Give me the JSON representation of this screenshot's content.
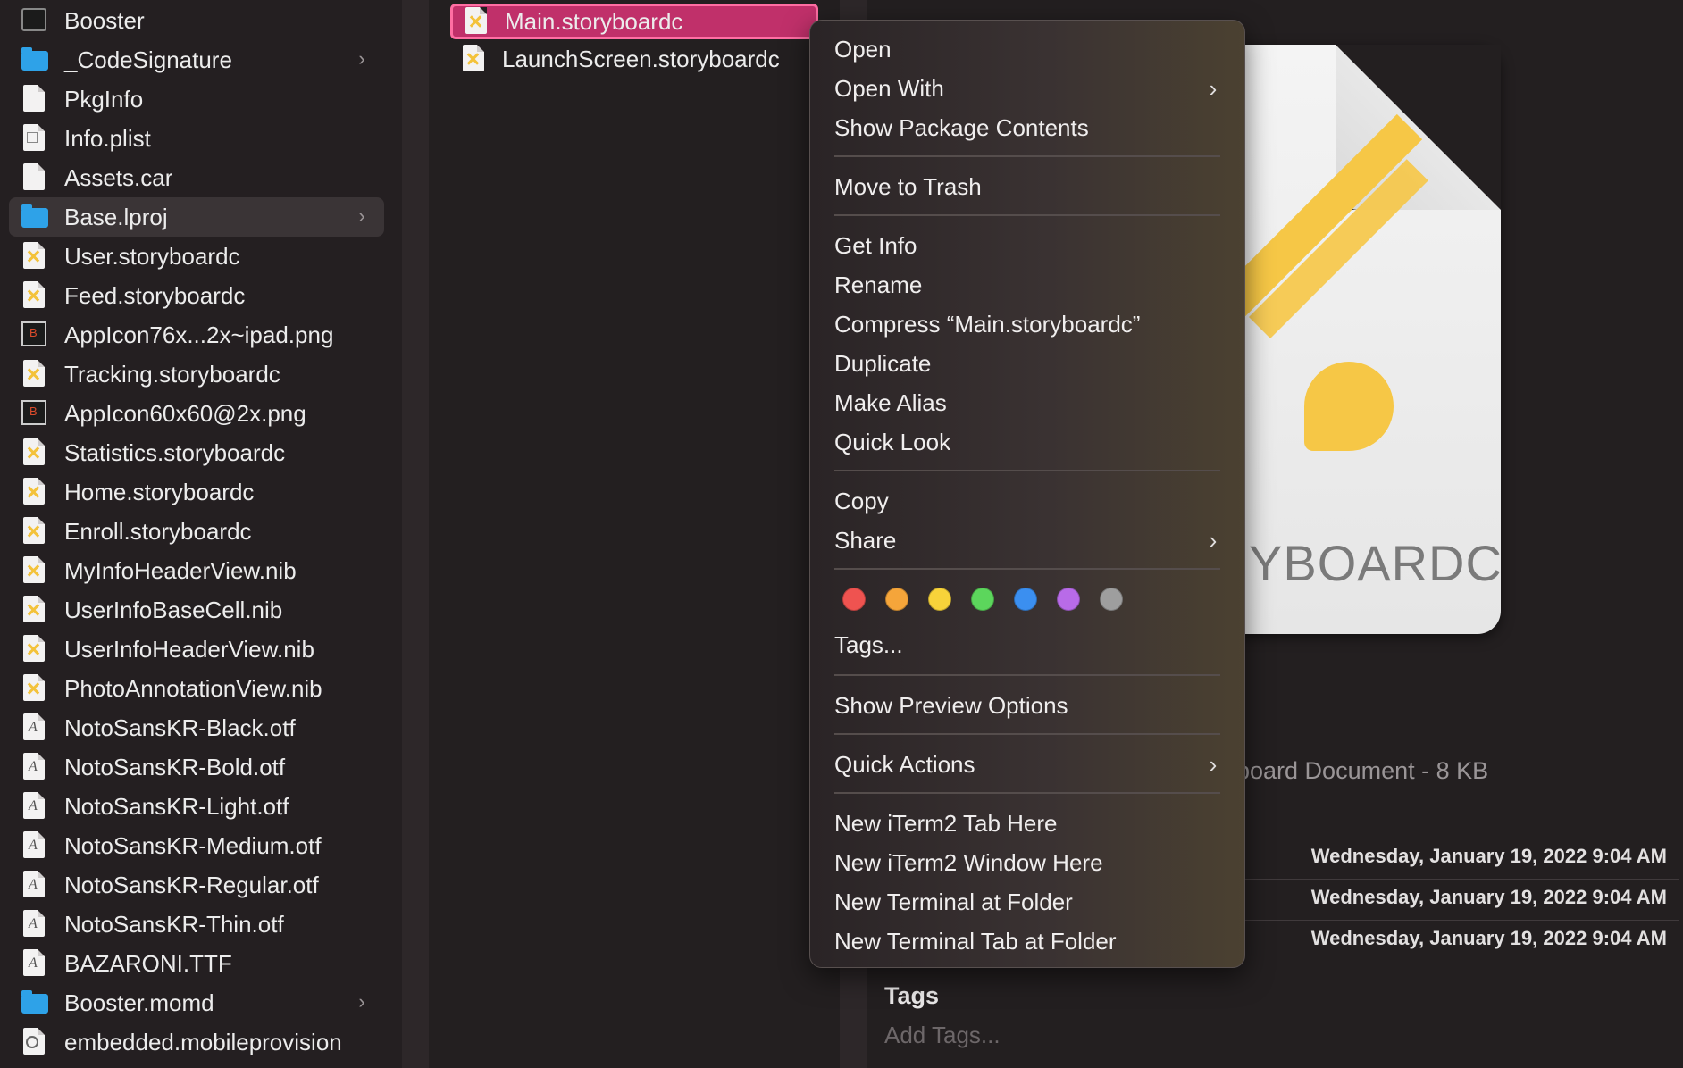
{
  "sidebar": {
    "items": [
      {
        "label": "Booster",
        "icon": "terminal-icon",
        "chevron": false
      },
      {
        "label": "_CodeSignature",
        "icon": "folder-icon",
        "chevron": true
      },
      {
        "label": "PkgInfo",
        "icon": "document-icon",
        "chevron": false
      },
      {
        "label": "Info.plist",
        "icon": "plist-icon",
        "chevron": false
      },
      {
        "label": "Assets.car",
        "icon": "document-icon",
        "chevron": false
      },
      {
        "label": "Base.lproj",
        "icon": "folder-icon",
        "chevron": true,
        "selected": true
      },
      {
        "label": "User.storyboardc",
        "icon": "storyboard-icon",
        "chevron": false
      },
      {
        "label": "Feed.storyboardc",
        "icon": "storyboard-icon",
        "chevron": false
      },
      {
        "label": "AppIcon76x...2x~ipad.png",
        "icon": "image-icon",
        "chevron": false
      },
      {
        "label": "Tracking.storyboardc",
        "icon": "storyboard-icon",
        "chevron": false
      },
      {
        "label": "AppIcon60x60@2x.png",
        "icon": "image-icon",
        "chevron": false
      },
      {
        "label": "Statistics.storyboardc",
        "icon": "storyboard-icon",
        "chevron": false
      },
      {
        "label": "Home.storyboardc",
        "icon": "storyboard-icon",
        "chevron": false
      },
      {
        "label": "Enroll.storyboardc",
        "icon": "storyboard-icon",
        "chevron": false
      },
      {
        "label": "MyInfoHeaderView.nib",
        "icon": "storyboard-icon",
        "chevron": false
      },
      {
        "label": "UserInfoBaseCell.nib",
        "icon": "storyboard-icon",
        "chevron": false
      },
      {
        "label": "UserInfoHeaderView.nib",
        "icon": "storyboard-icon",
        "chevron": false
      },
      {
        "label": "PhotoAnnotationView.nib",
        "icon": "storyboard-icon",
        "chevron": false
      },
      {
        "label": "NotoSansKR-Black.otf",
        "icon": "font-icon",
        "chevron": false
      },
      {
        "label": "NotoSansKR-Bold.otf",
        "icon": "font-icon",
        "chevron": false
      },
      {
        "label": "NotoSansKR-Light.otf",
        "icon": "font-icon",
        "chevron": false
      },
      {
        "label": "NotoSansKR-Medium.otf",
        "icon": "font-icon",
        "chevron": false
      },
      {
        "label": "NotoSansKR-Regular.otf",
        "icon": "font-icon",
        "chevron": false
      },
      {
        "label": "NotoSansKR-Thin.otf",
        "icon": "font-icon",
        "chevron": false
      },
      {
        "label": "BAZARONI.TTF",
        "icon": "font-icon",
        "chevron": false
      },
      {
        "label": "Booster.momd",
        "icon": "folder-icon",
        "chevron": true
      },
      {
        "label": "embedded.mobileprovision",
        "icon": "provision-icon",
        "chevron": false
      }
    ]
  },
  "column2": {
    "items": [
      {
        "label": "Main.storyboardc",
        "selected": true
      },
      {
        "label": "LaunchScreen.storyboardc",
        "selected": false
      }
    ]
  },
  "context_menu": {
    "open": "Open",
    "open_with": "Open With",
    "show_package_contents": "Show Package Contents",
    "move_to_trash": "Move to Trash",
    "get_info": "Get Info",
    "rename": "Rename",
    "compress": "Compress “Main.storyboardc”",
    "duplicate": "Duplicate",
    "make_alias": "Make Alias",
    "quick_look": "Quick Look",
    "copy": "Copy",
    "share": "Share",
    "tags": "Tags...",
    "show_preview_options": "Show Preview Options",
    "quick_actions": "Quick Actions",
    "new_iterm2_tab": "New iTerm2 Tab Here",
    "new_iterm2_window": "New iTerm2 Window Here",
    "new_terminal": "New Terminal at Folder",
    "new_terminal_tab": "New Terminal Tab at Folder",
    "tag_colors": [
      "#ef5350",
      "#f5a53a",
      "#f7d33a",
      "#5cd65c",
      "#3b8ff0",
      "#b86be8",
      "#9e9e9e"
    ]
  },
  "preview": {
    "icon_label": "YBOARDC",
    "kind": "board Document - 8 KB",
    "dates": [
      "Wednesday, January 19, 2022 9:04 AM",
      "Wednesday, January 19, 2022 9:04 AM",
      "Wednesday, January 19, 2022 9:04 AM"
    ],
    "tags_heading": "Tags",
    "add_tags_placeholder": "Add Tags..."
  }
}
